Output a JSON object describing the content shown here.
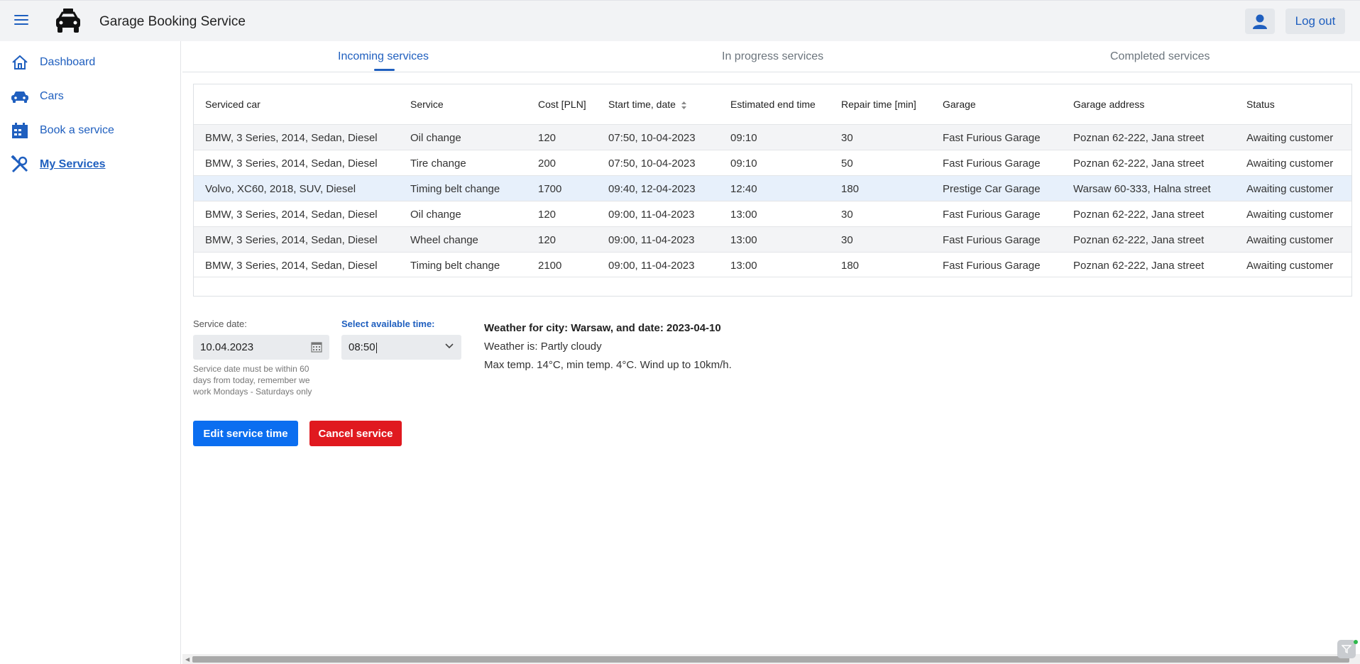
{
  "header": {
    "title": "Garage Booking Service",
    "logout_label": "Log out"
  },
  "sidebar": {
    "items": [
      {
        "label": "Dashboard",
        "icon": "home-icon"
      },
      {
        "label": "Cars",
        "icon": "car-icon"
      },
      {
        "label": "Book a service",
        "icon": "calendar-icon"
      },
      {
        "label": "My Services",
        "icon": "tools-icon",
        "active": true
      }
    ]
  },
  "tabs": [
    {
      "label": "Incoming services",
      "active": true
    },
    {
      "label": "In progress services"
    },
    {
      "label": "Completed services"
    }
  ],
  "table": {
    "columns": [
      "Serviced car",
      "Service",
      "Cost [PLN]",
      "Start time, date",
      "Estimated end time",
      "Repair time [min]",
      "Garage",
      "Garage address",
      "Status"
    ],
    "rows": [
      [
        "BMW, 3 Series, 2014, Sedan, Diesel",
        "Oil change",
        "120",
        "07:50, 10-04-2023",
        "09:10",
        "30",
        "Fast Furious Garage",
        "Poznan 62-222, Jana street",
        "Awaiting customer"
      ],
      [
        "BMW, 3 Series, 2014, Sedan, Diesel",
        "Tire change",
        "200",
        "07:50, 10-04-2023",
        "09:10",
        "50",
        "Fast Furious Garage",
        "Poznan 62-222, Jana street",
        "Awaiting customer"
      ],
      [
        "Volvo, XC60, 2018, SUV, Diesel",
        "Timing belt change",
        "1700",
        "09:40, 12-04-2023",
        "12:40",
        "180",
        "Prestige Car Garage",
        "Warsaw 60-333, Halna street",
        "Awaiting customer"
      ],
      [
        "BMW, 3 Series, 2014, Sedan, Diesel",
        "Oil change",
        "120",
        "09:00, 11-04-2023",
        "13:00",
        "30",
        "Fast Furious Garage",
        "Poznan 62-222, Jana street",
        "Awaiting customer"
      ],
      [
        "BMW, 3 Series, 2014, Sedan, Diesel",
        "Wheel change",
        "120",
        "09:00, 11-04-2023",
        "13:00",
        "30",
        "Fast Furious Garage",
        "Poznan 62-222, Jana street",
        "Awaiting customer"
      ],
      [
        "BMW, 3 Series, 2014, Sedan, Diesel",
        "Timing belt change",
        "2100",
        "09:00, 11-04-2023",
        "13:00",
        "180",
        "Fast Furious Garage",
        "Poznan 62-222, Jana street",
        "Awaiting customer"
      ]
    ],
    "selected_row": 2
  },
  "form": {
    "date_label": "Service date:",
    "date_value": "10.04.2023",
    "date_help": "Service date must be within 60 days from today, remember we work Mondays - Saturdays only",
    "time_label": "Select available time:",
    "time_value": "08:50"
  },
  "weather": {
    "title": "Weather for city: Warsaw, and date: 2023-04-10",
    "condition": "Weather is: Partly cloudy",
    "details": "Max temp. 14°C, min temp. 4°C. Wind up to 10km/h."
  },
  "actions": {
    "edit_label": "Edit service time",
    "cancel_label": "Cancel service"
  },
  "colors": {
    "primary": "#1f5fbf",
    "edit_button": "#0b6ef0",
    "cancel_button": "#e0191f",
    "selected_row": "#e7f0fb"
  }
}
